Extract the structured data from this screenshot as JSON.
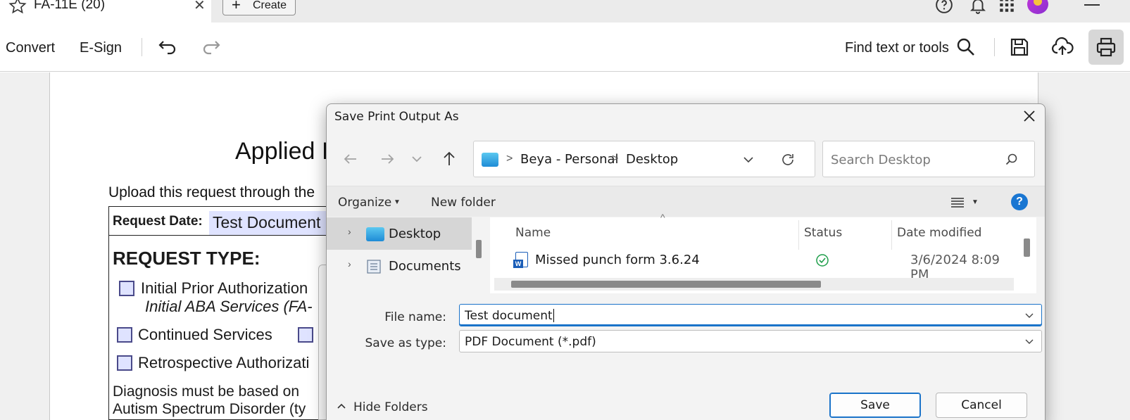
{
  "tab": {
    "title": "FA-11E (20)",
    "close": "✕"
  },
  "create": {
    "label": "Create",
    "plus": "+"
  },
  "toolbar": {
    "convert": "Convert",
    "esign": "E-Sign",
    "find": "Find text or tools"
  },
  "document": {
    "title": "Applied I",
    "upload": "Upload this request through the",
    "request_date_label": "Request Date:",
    "request_date_value": "Test Document",
    "request_type": "REQUEST TYPE:",
    "options": [
      {
        "label": "Initial Prior Authorization",
        "sub": "Initial ABA Services (FA-"
      },
      {
        "label": "Continued Services"
      },
      {
        "label": "Retrospective Authorizati"
      }
    ],
    "diag_line1": "Diagnosis must be based on",
    "diag_line2": "Autism Spectrum Disorder (ty"
  },
  "dialog": {
    "title": "Save Print Output As",
    "breadcrumb": [
      "Beya - Personal",
      "Desktop"
    ],
    "breadcrumb_sep": ">",
    "search_placeholder": "Search Desktop",
    "organize": "Organize",
    "new_folder": "New folder",
    "help": "?",
    "nav_items": [
      {
        "label": "Desktop",
        "selected": true
      },
      {
        "label": "Documents",
        "selected": false
      }
    ],
    "columns": {
      "name": "Name",
      "status": "Status",
      "date": "Date modified"
    },
    "files": [
      {
        "name": "Missed punch form 3.6.24",
        "status": "synced",
        "date": "3/6/2024 8:09 PM"
      }
    ],
    "file_name_label": "File name:",
    "file_name_value": "Test document",
    "save_type_label": "Save as type:",
    "save_type_value": "PDF Document (*.pdf)",
    "hide_folders": "Hide Folders",
    "save": "Save",
    "cancel": "Cancel"
  },
  "colors": {
    "accent": "#1a73c9",
    "form_field": "#dfe3ff",
    "status_ok": "#1e9e4a"
  }
}
